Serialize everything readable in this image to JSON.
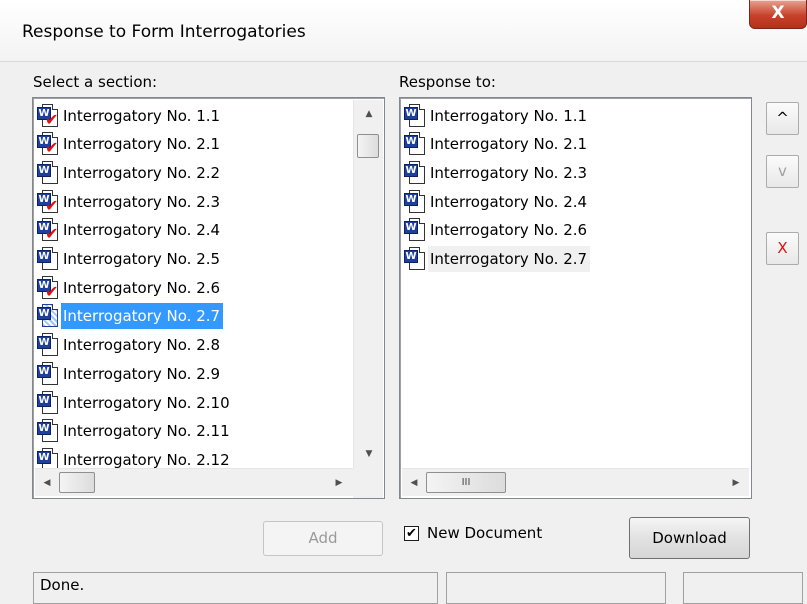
{
  "window": {
    "title": "Response to Form Interrogatories",
    "close_label": "X"
  },
  "left_panel": {
    "label": "Select a section:",
    "selected_index": 7,
    "items": [
      {
        "label": "Interrogatory No. 1.1",
        "icon": "word-doc-checked-icon"
      },
      {
        "label": "Interrogatory No. 2.1",
        "icon": "word-doc-checked-icon"
      },
      {
        "label": "Interrogatory No. 2.2",
        "icon": "word-doc-icon"
      },
      {
        "label": "Interrogatory No. 2.3",
        "icon": "word-doc-checked-icon"
      },
      {
        "label": "Interrogatory No. 2.4",
        "icon": "word-doc-checked-icon"
      },
      {
        "label": "Interrogatory No. 2.5",
        "icon": "word-doc-icon"
      },
      {
        "label": "Interrogatory No. 2.6",
        "icon": "word-doc-checked-icon"
      },
      {
        "label": "Interrogatory No. 2.7",
        "icon": "word-doc-selected-icon"
      },
      {
        "label": "Interrogatory No. 2.8",
        "icon": "word-doc-icon"
      },
      {
        "label": "Interrogatory No. 2.9",
        "icon": "word-doc-icon"
      },
      {
        "label": "Interrogatory No. 2.10",
        "icon": "word-doc-icon"
      },
      {
        "label": "Interrogatory No. 2.11",
        "icon": "word-doc-icon"
      },
      {
        "label": "Interrogatory No. 2.12",
        "icon": "word-doc-icon"
      }
    ]
  },
  "right_panel": {
    "label": "Response to:",
    "items": [
      {
        "label": "Interrogatory No. 1.1",
        "icon": "word-doc-icon"
      },
      {
        "label": "Interrogatory No. 2.1",
        "icon": "word-doc-icon"
      },
      {
        "label": "Interrogatory No. 2.3",
        "icon": "word-doc-icon"
      },
      {
        "label": "Interrogatory No. 2.4",
        "icon": "word-doc-icon"
      },
      {
        "label": "Interrogatory No. 2.6",
        "icon": "word-doc-icon"
      },
      {
        "label": "Interrogatory No. 2.7",
        "icon": "word-doc-icon"
      }
    ]
  },
  "side_buttons": {
    "up": "^",
    "down": "v",
    "remove": "X"
  },
  "buttons": {
    "add": "Add",
    "download": "Download"
  },
  "new_document": {
    "label": "New Document",
    "checked": true,
    "check_glyph": "✔"
  },
  "statusbar": {
    "text": "Done."
  },
  "scroll_glyphs": {
    "up": "▲",
    "down": "▼",
    "left": "◀",
    "right": "▶",
    "grip": "III"
  },
  "colors": {
    "selection": "#3399ff",
    "remove_red": "#e01010",
    "word_blue": "#1d3f9e"
  }
}
